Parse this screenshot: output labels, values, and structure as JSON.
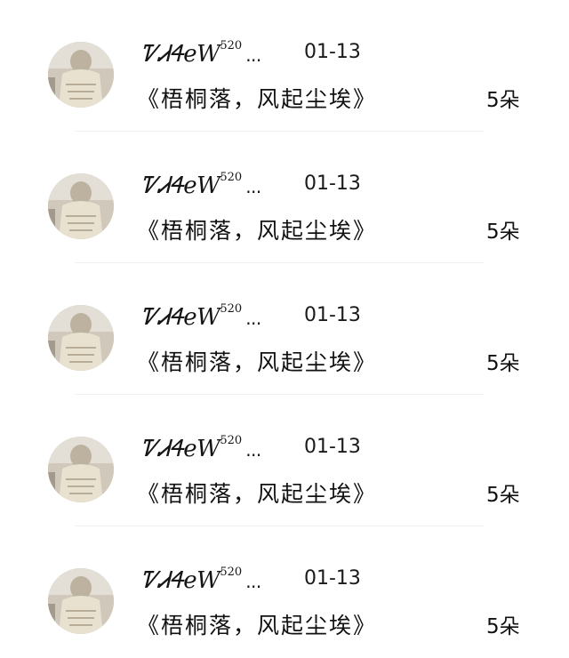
{
  "gift_list": {
    "items": [
      {
        "name": "ᏤᏗᏎeW",
        "name_suffix": "520",
        "ellipsis": "...",
        "date": "01-13",
        "title": "《梧桐落，风起尘埃》",
        "count": "5朵"
      },
      {
        "name": "ᏤᏗᏎeW",
        "name_suffix": "520",
        "ellipsis": "...",
        "date": "01-13",
        "title": "《梧桐落，风起尘埃》",
        "count": "5朵"
      },
      {
        "name": "ᏤᏗᏎeW",
        "name_suffix": "520",
        "ellipsis": "...",
        "date": "01-13",
        "title": "《梧桐落，风起尘埃》",
        "count": "5朵"
      },
      {
        "name": "ᏤᏗᏎeW",
        "name_suffix": "520",
        "ellipsis": "...",
        "date": "01-13",
        "title": "《梧桐落，风起尘埃》",
        "count": "5朵"
      },
      {
        "name": "ᏤᏗᏎeW",
        "name_suffix": "520",
        "ellipsis": "...",
        "date": "01-13",
        "title": "《梧桐落，风起尘埃》",
        "count": "5朵"
      }
    ]
  }
}
